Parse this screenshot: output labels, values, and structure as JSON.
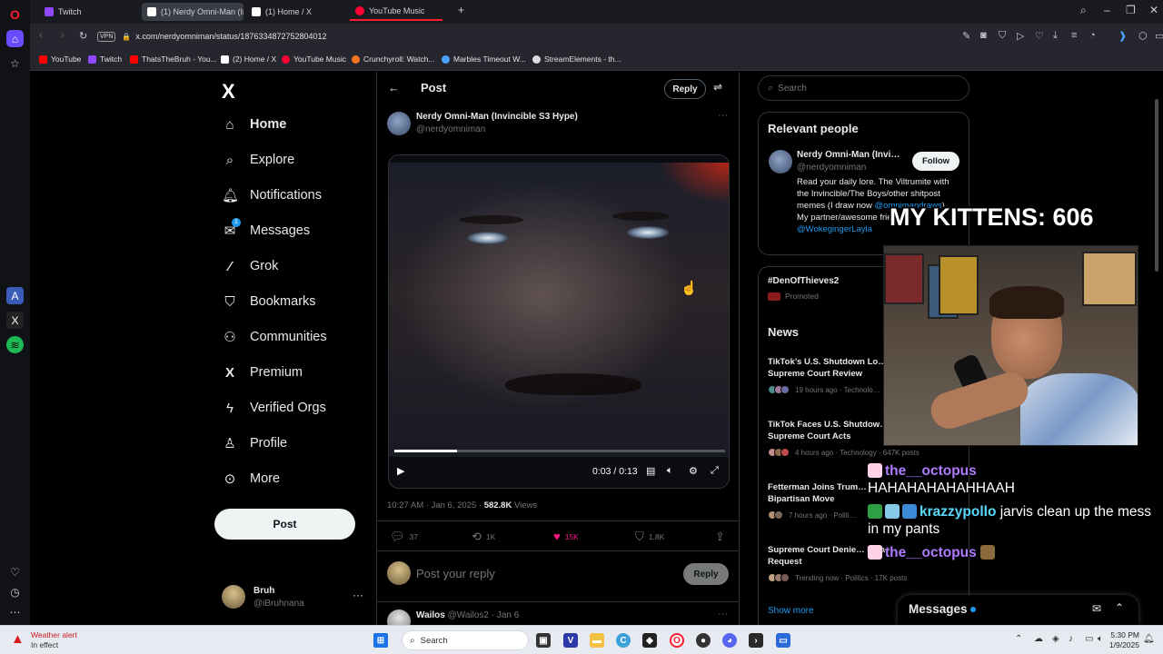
{
  "browser": {
    "tabs": [
      {
        "label": "Twitch",
        "color": "#9146ff",
        "active": false
      },
      {
        "label": "(1) Nerdy Omni-Man (Invi…",
        "color": "#ffffff",
        "active": true
      },
      {
        "label": "(1) Home / X",
        "color": "#ffffff",
        "active": false
      },
      {
        "label": "YouTube Music",
        "color": "#ff0033",
        "active": false
      }
    ],
    "vpn_label": "VPN",
    "url": "x.com/nerdyomniman/status/1876334872752804012",
    "bookmarks": [
      {
        "label": "YouTube",
        "color": "#ff0000"
      },
      {
        "label": "Twitch",
        "color": "#9146ff"
      },
      {
        "label": "ThatsTheBruh - You...",
        "color": "#ff0000"
      },
      {
        "label": "(2) Home / X",
        "color": "#ffffff"
      },
      {
        "label": "YouTube Music",
        "color": "#ff0033"
      },
      {
        "label": "Crunchyroll: Watch...",
        "color": "#f47521"
      },
      {
        "label": "Marbles Timeout W...",
        "color": "#4aa3ff"
      },
      {
        "label": "StreamElements - th...",
        "color": "#dddddd"
      }
    ]
  },
  "nav": {
    "logo": "X",
    "items": [
      {
        "label": "Home",
        "icon": "home-icon"
      },
      {
        "label": "Explore",
        "icon": "search-icon"
      },
      {
        "label": "Notifications",
        "icon": "bell-icon"
      },
      {
        "label": "Messages",
        "icon": "envelope-icon",
        "badge": "1"
      },
      {
        "label": "Grok",
        "icon": "grok-icon"
      },
      {
        "label": "Bookmarks",
        "icon": "bookmark-icon"
      },
      {
        "label": "Communities",
        "icon": "people-icon"
      },
      {
        "label": "Premium",
        "icon": "x-icon"
      },
      {
        "label": "Verified Orgs",
        "icon": "bolt-icon"
      },
      {
        "label": "Profile",
        "icon": "person-icon"
      },
      {
        "label": "More",
        "icon": "more-circle-icon"
      }
    ],
    "post_button": "Post",
    "account": {
      "name": "Bruh",
      "handle": "@iBruhnana"
    }
  },
  "post": {
    "header_title": "Post",
    "reply_pill": "Reply",
    "author_name": "Nerdy Omni-Man (Invincible S3 Hype)",
    "author_handle": "@nerdyomniman",
    "video": {
      "time": "0:03 / 0:13",
      "progress": 0.19
    },
    "timestamp": "10:27 AM · Jan 6, 2025 · ",
    "views_count": "582.8K",
    "views_label": " Views",
    "stats": {
      "replies": "37",
      "reposts": "1K",
      "likes": "15K",
      "bookmarks": "1.8K"
    },
    "reply_placeholder": "Post your reply",
    "reply_button": "Reply",
    "next_reply": {
      "name": "Wailos",
      "meta": "@Wailos2 · Jan 6"
    }
  },
  "sidebar": {
    "search_placeholder": "Search",
    "relevant": {
      "title": "Relevant people",
      "name": "Nerdy Omni-Man (Invi…",
      "handle": "@nerdyomniman",
      "follow": "Follow",
      "bio_1": "Read your daily lore. The Viltrumite with the Invincible/The Boys/other shitpost memes (I draw now ",
      "bio_link_1": "@omnimandraws",
      "bio_2": "). My partner/awesome friend: ",
      "bio_link_2": "@WokegingerLayla"
    },
    "promoted": {
      "tag": "#DenOfThieves2",
      "label": "Promoted"
    },
    "news": {
      "title": "News",
      "items": [
        {
          "title": "TikTok’s U.S. Shutdown Lo… Supreme Court Review",
          "meta": "19 hours ago · Technolo…"
        },
        {
          "title": "TikTok Faces U.S. Shutdow… Supreme Court Acts",
          "meta": "4 hours ago · Technology · 647K posts"
        },
        {
          "title": "Fetterman Joins Trum… Bipartisan Move",
          "meta": "7 hours ago · Politi…"
        },
        {
          "title": "Supreme Court Denie… Delay Request",
          "meta": "Trending now · Politics · 17K posts"
        }
      ],
      "show_more": "Show more"
    }
  },
  "overlay": {
    "kittens": "MY KITTENS: 606",
    "chat": [
      {
        "user": "the__octopus",
        "text": "HAHAHAHAHAHHAAH"
      },
      {
        "user": "krazzypollo",
        "text": " jarvis clean up the mess in my pants"
      },
      {
        "user": "the__octopus",
        "text": ""
      }
    ]
  },
  "messages_drawer": {
    "title": "Messages"
  },
  "taskbar": {
    "weather_title": "Weather alert",
    "weather_sub": "In effect",
    "search": "Search",
    "time": "5:30 PM",
    "date": "1/9/2025"
  }
}
